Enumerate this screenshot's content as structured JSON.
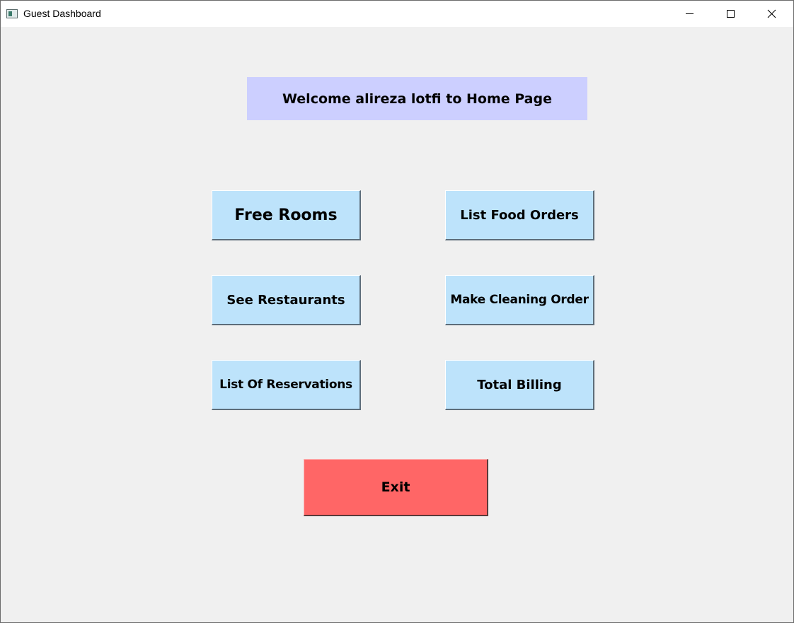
{
  "window": {
    "title": "Guest Dashboard",
    "icon": "app-window-icon"
  },
  "welcome": {
    "text": "Welcome alireza lotfi to Home Page"
  },
  "buttons": {
    "free_rooms": "Free Rooms",
    "list_food_orders": "List Food Orders",
    "see_restaurants": "See Restaurants",
    "make_cleaning_order": "Make Cleaning Order",
    "list_of_reservations": "List Of Reservations",
    "total_billing": "Total Billing",
    "exit": "Exit"
  },
  "colors": {
    "welcome_bg": "#cccfff",
    "button_bg": "#bde3fb",
    "exit_bg": "#ff6666",
    "window_bg": "#f0f0f0"
  }
}
